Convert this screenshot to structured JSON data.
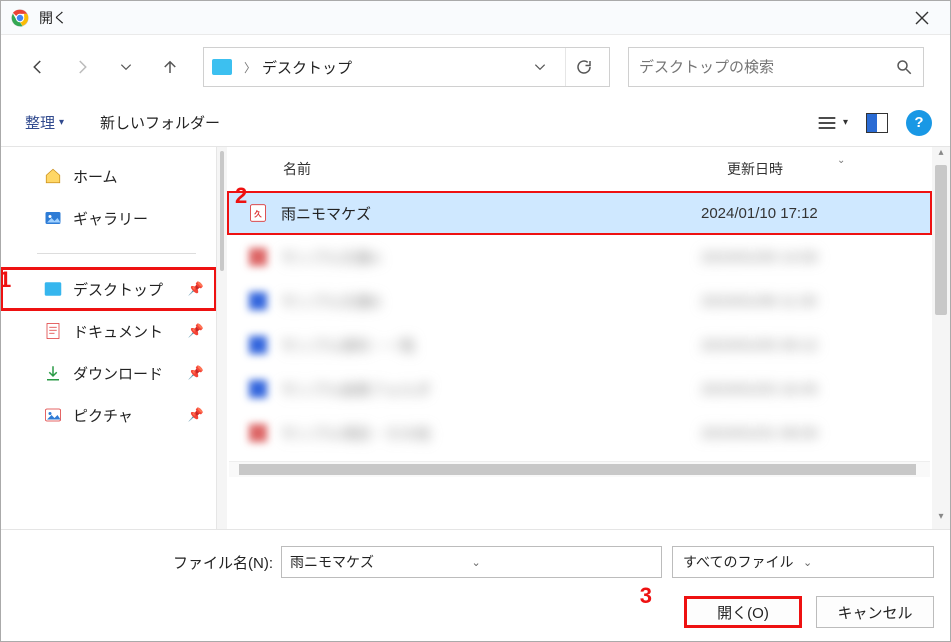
{
  "titlebar": {
    "title": "開く"
  },
  "nav": {
    "path_text": "デスクトップ"
  },
  "search": {
    "placeholder": "デスクトップの検索"
  },
  "toolbar": {
    "organize_label": "整理",
    "new_folder_label": "新しいフォルダー",
    "help_label": "?"
  },
  "sidebar": {
    "items": [
      {
        "label": "ホーム"
      },
      {
        "label": "ギャラリー"
      },
      {
        "label": "デスクトップ"
      },
      {
        "label": "ドキュメント"
      },
      {
        "label": "ダウンロード"
      },
      {
        "label": "ピクチャ"
      }
    ]
  },
  "columns": {
    "name": "名前",
    "date": "更新日時"
  },
  "files": {
    "rows": [
      {
        "name": "雨ニモマケズ",
        "date": "2024/01/10 17:12",
        "selected": true,
        "type": "pdf"
      },
      {
        "name": "サンプル文書A",
        "date": "2024/01/09 14:00",
        "blurred": true
      },
      {
        "name": "サンプル文書B",
        "date": "2024/01/08 11:30",
        "blurred": true
      },
      {
        "name": "サンプル資料・一覧",
        "date": "2024/01/05 09:12",
        "blurred": true
      },
      {
        "name": "サンプル画像フォルダ",
        "date": "2024/01/03 16:45",
        "blurred": true
      },
      {
        "name": "サンプル項目・その他",
        "date": "2024/01/01 08:00",
        "blurred": true
      }
    ]
  },
  "bottom": {
    "filename_label": "ファイル名(N):",
    "filename_value": "雨ニモマケズ",
    "filter_label": "すべてのファイル",
    "open_label": "開く(O)",
    "cancel_label": "キャンセル"
  },
  "annotations": {
    "a1": "1",
    "a2": "2",
    "a3": "3"
  }
}
